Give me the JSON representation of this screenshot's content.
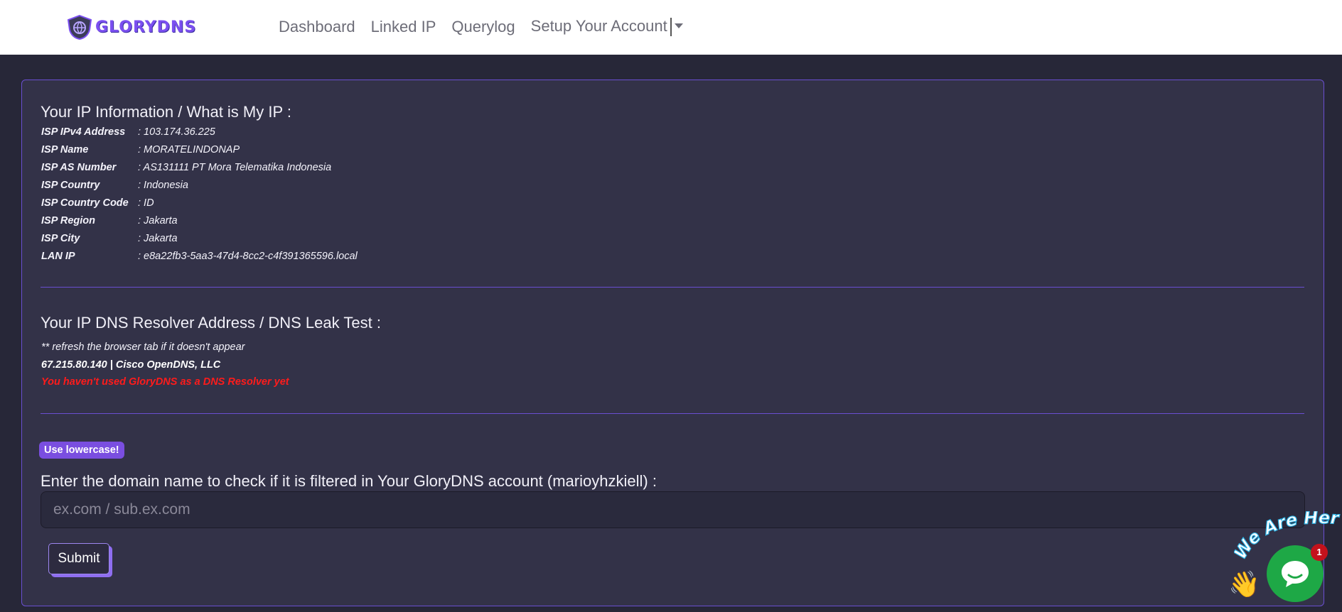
{
  "brand": {
    "name": "GLORYDNS"
  },
  "nav": {
    "links": [
      "Dashboard",
      "Linked IP",
      "Querylog",
      "Setup Your Account"
    ]
  },
  "ip_info": {
    "title": "Your IP Information / What is My IP :",
    "rows": [
      {
        "label": "ISP IPv4 Address",
        "value": ": 103.174.36.225"
      },
      {
        "label": "ISP Name",
        "value": ": MORATELINDONAP"
      },
      {
        "label": "ISP AS Number",
        "value": ": AS131111 PT Mora Telematika Indonesia"
      },
      {
        "label": "ISP Country",
        "value": ": Indonesia"
      },
      {
        "label": "ISP Country Code",
        "value": ": ID"
      },
      {
        "label": "ISP Region",
        "value": ": Jakarta"
      },
      {
        "label": "ISP City",
        "value": ": Jakarta"
      },
      {
        "label": "LAN IP",
        "value": ": e8a22fb3-5aa3-47d4-8cc2-c4f391365596.local"
      }
    ]
  },
  "dns_test": {
    "title": "Your IP DNS Resolver Address / DNS Leak Test :",
    "note": "** refresh the browser tab if it doesn't appear",
    "resolver": "67.215.80.140 | Cisco OpenDNS, LLC",
    "warning": "You haven't used GloryDNS as a DNS Resolver yet"
  },
  "domain_check": {
    "badge": "Use lowercase!",
    "label": "Enter the domain name to check if it is filtered in Your GloryDNS account (marioyhzkiell) :",
    "placeholder": "ex.com / sub.ex.com",
    "submit": "Submit"
  },
  "chat": {
    "tagline": "We Are Here!",
    "badge_count": "1"
  },
  "colors": {
    "accent": "#7a4ee0",
    "panel": "#333248",
    "background": "#272738",
    "warning": "#ff1b1b",
    "chat": "#1ea846"
  }
}
